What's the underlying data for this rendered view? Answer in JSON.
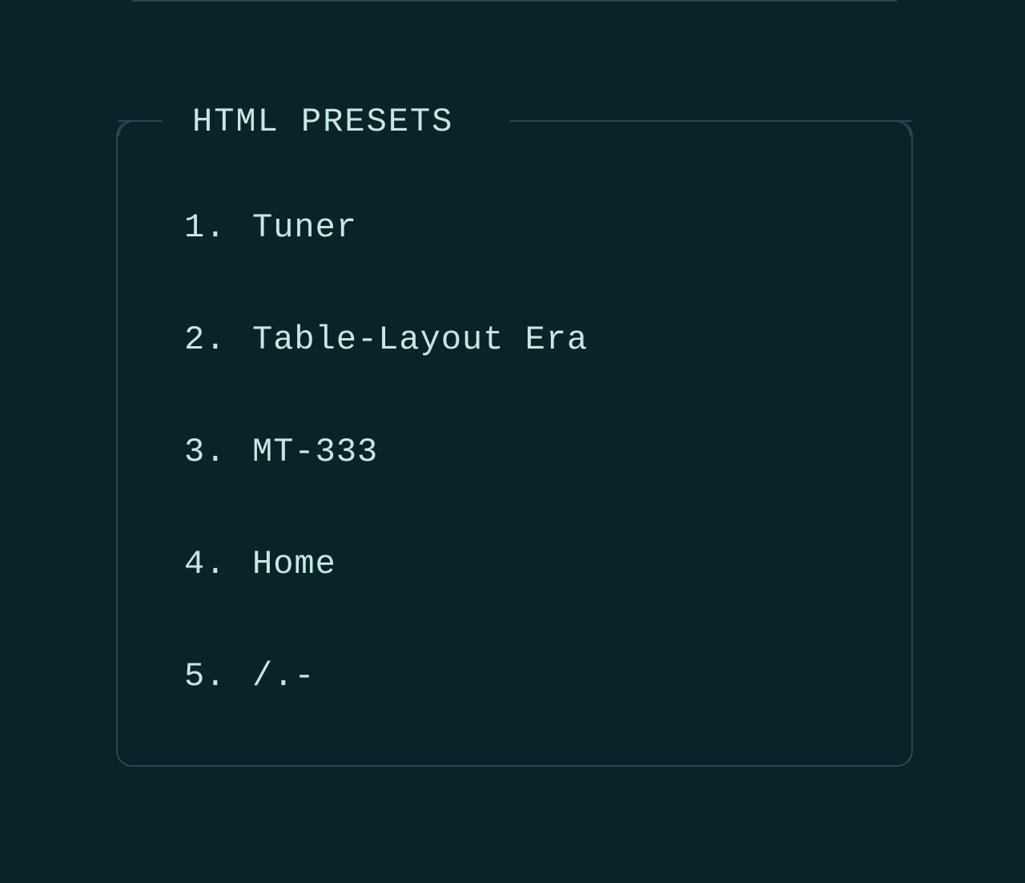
{
  "panel": {
    "title": "HTML PRESETS",
    "items": [
      {
        "number": "1.",
        "label": "Tuner"
      },
      {
        "number": "2.",
        "label": "Table-Layout Era"
      },
      {
        "number": "3.",
        "label": "MT-333"
      },
      {
        "number": "4.",
        "label": "Home"
      },
      {
        "number": "5.",
        "label": "/.-"
      }
    ]
  }
}
